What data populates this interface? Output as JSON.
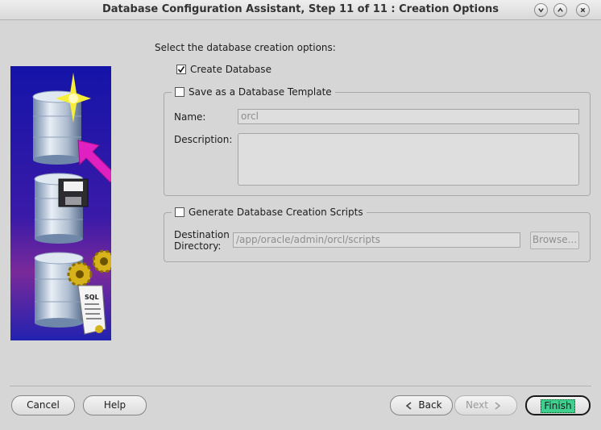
{
  "window": {
    "title": "Database Configuration Assistant, Step 11 of 11 : Creation Options"
  },
  "intro_text": "Select the database creation options:",
  "create_database": {
    "label": "Create Database",
    "checked": true
  },
  "save_template": {
    "label": "Save as a Database Template",
    "checked": false,
    "name_label": "Name:",
    "name_value": "orcl",
    "description_label": "Description:",
    "description_value": ""
  },
  "generate_scripts": {
    "label": "Generate Database Creation Scripts",
    "checked": false,
    "dest_label_line1": "Destination",
    "dest_label_line2": "Directory:",
    "dest_value": "/app/oracle/admin/orcl/scripts",
    "browse_label": "Browse..."
  },
  "buttons": {
    "cancel": "Cancel",
    "help": "Help",
    "back": "Back",
    "next": "Next",
    "finish": "Finish"
  },
  "graphic_labels": {
    "sql": "SQL"
  },
  "colors": {
    "graphic_blue": "#1a1aa6",
    "graphic_purple": "#7a2a9a",
    "arrow_magenta": "#e020c0",
    "finish_highlight": "#3fcf8f"
  }
}
